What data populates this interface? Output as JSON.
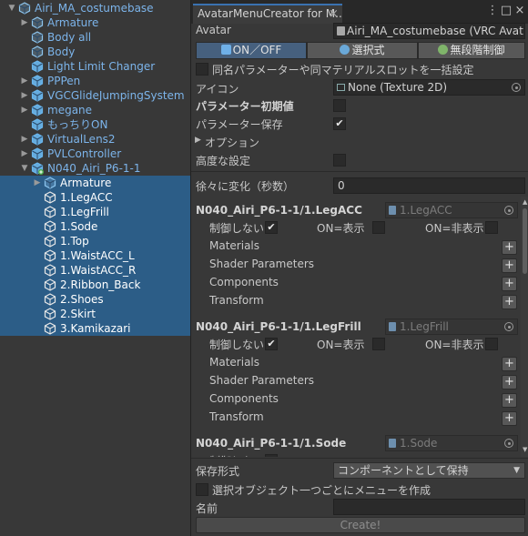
{
  "hierarchy": {
    "rows": [
      {
        "label": "Airi_MA_costumebase",
        "fold": "open",
        "indent": 0,
        "color": "blue",
        "icon": "prefab",
        "selected": false
      },
      {
        "label": "Armature",
        "fold": "closed",
        "indent": 1,
        "color": "blue",
        "icon": "prefab",
        "selected": false
      },
      {
        "label": "Body all",
        "fold": "none",
        "indent": 1,
        "color": "blue",
        "icon": "prefab",
        "selected": false
      },
      {
        "label": "Body",
        "fold": "none",
        "indent": 1,
        "color": "blue",
        "icon": "prefab",
        "selected": false
      },
      {
        "label": "Light Limit Changer",
        "fold": "none",
        "indent": 1,
        "color": "blue",
        "icon": "prefab-solid",
        "selected": false
      },
      {
        "label": "PPPen",
        "fold": "closed",
        "indent": 1,
        "color": "blue",
        "icon": "prefab-solid",
        "selected": false
      },
      {
        "label": "VGCGlideJumpingSystem",
        "fold": "closed",
        "indent": 1,
        "color": "blue",
        "icon": "prefab-solid",
        "selected": false
      },
      {
        "label": "megane",
        "fold": "closed",
        "indent": 1,
        "color": "blue",
        "icon": "prefab-solid",
        "selected": false
      },
      {
        "label": "もっちりON",
        "fold": "none",
        "indent": 1,
        "color": "blue",
        "icon": "prefab-solid",
        "selected": false
      },
      {
        "label": "VirtualLens2",
        "fold": "closed",
        "indent": 1,
        "color": "blue",
        "icon": "prefab-solid",
        "selected": false
      },
      {
        "label": "PVLController",
        "fold": "closed",
        "indent": 1,
        "color": "blue",
        "icon": "prefab-solid",
        "selected": false
      },
      {
        "label": "N040_Airi_P6-1-1",
        "fold": "open",
        "indent": 1,
        "color": "blue",
        "icon": "prefab-added",
        "selected": false
      },
      {
        "label": "Armature",
        "fold": "closed",
        "indent": 2,
        "color": "blue",
        "icon": "prefab",
        "selected": true
      },
      {
        "label": "1.LegACC",
        "fold": "none",
        "indent": 2,
        "color": "white",
        "icon": "gameobject",
        "selected": true
      },
      {
        "label": "1.LegFrill",
        "fold": "none",
        "indent": 2,
        "color": "white",
        "icon": "gameobject",
        "selected": true
      },
      {
        "label": "1.Sode",
        "fold": "none",
        "indent": 2,
        "color": "white",
        "icon": "gameobject",
        "selected": true
      },
      {
        "label": "1.Top",
        "fold": "none",
        "indent": 2,
        "color": "white",
        "icon": "gameobject",
        "selected": true
      },
      {
        "label": "1.WaistACC_L",
        "fold": "none",
        "indent": 2,
        "color": "white",
        "icon": "gameobject",
        "selected": true
      },
      {
        "label": "1.WaistACC_R",
        "fold": "none",
        "indent": 2,
        "color": "white",
        "icon": "gameobject",
        "selected": true
      },
      {
        "label": "2.Ribbon_Back",
        "fold": "none",
        "indent": 2,
        "color": "white",
        "icon": "gameobject",
        "selected": true
      },
      {
        "label": "2.Shoes",
        "fold": "none",
        "indent": 2,
        "color": "white",
        "icon": "gameobject",
        "selected": true
      },
      {
        "label": "2.Skirt",
        "fold": "none",
        "indent": 2,
        "color": "white",
        "icon": "gameobject",
        "selected": true
      },
      {
        "label": "3.Kamikazari",
        "fold": "none",
        "indent": 2,
        "color": "white",
        "icon": "gameobject",
        "selected": true
      }
    ]
  },
  "window": {
    "tab_title": "AvatarMenuCreator for M...",
    "tab_close": "×",
    "menu_glyph": "⋮",
    "maximize_glyph": "□",
    "close_glyph": "×"
  },
  "avatar": {
    "label": "Avatar",
    "value": "Airi_MA_costumebase (VRC Avat"
  },
  "modes": [
    {
      "label": "ON／OFF",
      "active": true,
      "icon": "toggle"
    },
    {
      "label": "選択式",
      "active": false,
      "icon": "select"
    },
    {
      "label": "無段階制御",
      "active": false,
      "icon": "radial"
    }
  ],
  "same_param_label": "同名パラメーターや同マテリアルスロットを一括設定",
  "icon_field": {
    "label": "アイコン",
    "value": "None (Texture 2D)"
  },
  "param_initial_label": "パラメーター初期値",
  "param_save_label": "パラメーター保存",
  "options_label": "オプション",
  "advanced_label": "高度な設定",
  "gradual": {
    "label": "徐々に変化（秒数）",
    "value": "0"
  },
  "items": [
    {
      "title": "N040_Airi_P6-1-1/1.LegACC",
      "object": "1.LegACC",
      "no_control_label": "制御しない",
      "on_show_label": "ON=表示",
      "on_hide_label": "ON=非表示",
      "no_control": true,
      "on_show": false,
      "on_hide": false,
      "sections": [
        "Materials",
        "Shader Parameters",
        "Components",
        "Transform"
      ]
    },
    {
      "title": "N040_Airi_P6-1-1/1.LegFrill",
      "object": "1.LegFrill",
      "no_control_label": "制御しない",
      "on_show_label": "ON=表示",
      "on_hide_label": "ON=非表示",
      "no_control": true,
      "on_show": false,
      "on_hide": false,
      "sections": [
        "Materials",
        "Shader Parameters",
        "Components",
        "Transform"
      ]
    },
    {
      "title": "N040_Airi_P6-1-1/1.Sode",
      "object": "1.Sode",
      "no_control_label": "制御しない"
    }
  ],
  "save_format": {
    "label": "保存形式",
    "value": "コンポーネントとして保持"
  },
  "per_object_label": "選択オブジェクト一つごとにメニューを作成",
  "name_field": {
    "label": "名前",
    "value": ""
  },
  "create_label": "Create!",
  "colors": {
    "selection": "#2c5d87",
    "prefab_blue": "#7cb4ea",
    "panel": "#383838",
    "tab_accent": "#3a72b0"
  }
}
